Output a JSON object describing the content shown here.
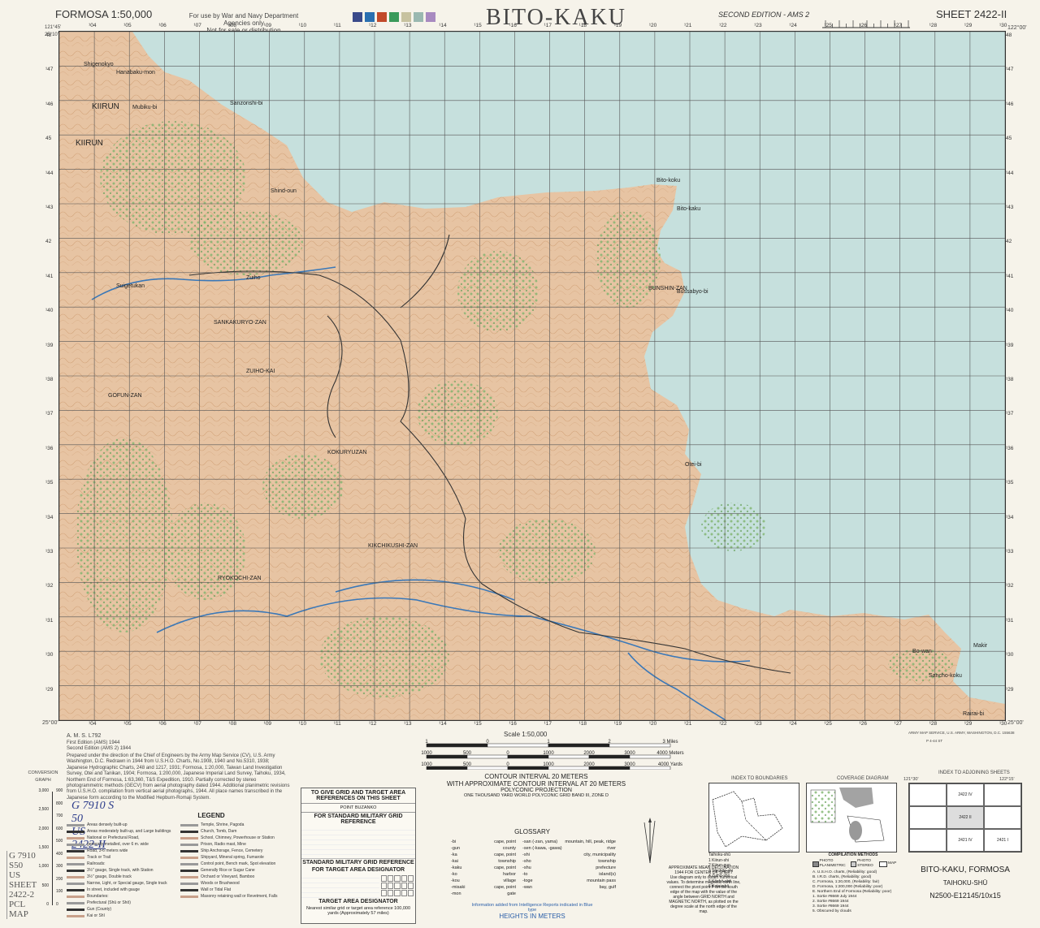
{
  "header": {
    "series": "FORMOSA 1:50,000",
    "use_note_line1": "For use by War and Navy Department Agencies only",
    "use_note_line2": "Not for sale or distribution",
    "title": "BITO-KAKU",
    "edition": "SECOND EDITION - AMS 2",
    "sheet": "SHEET 2422-II",
    "swatch_colors": [
      "#3a4a8a",
      "#2a6fb0",
      "#c24a2a",
      "#3a9a5a",
      "#c7c2a0",
      "#9ab8b0",
      "#a88ac0"
    ]
  },
  "map": {
    "sea_color": "#c6e0dd",
    "land_color": "#e7c4a3",
    "forest_color": "#9cc48a",
    "grid_color": "#555",
    "grid_col_labels": [
      "¹04",
      "¹05",
      "¹06",
      "¹07",
      "¹08",
      "¹09",
      "¹10",
      "¹11",
      "¹12",
      "¹13",
      "¹14",
      "¹15",
      "¹16",
      "¹17",
      "¹18",
      "¹19",
      "¹20",
      "¹21",
      "¹22",
      "¹23",
      "¹24",
      "¹25",
      "¹26",
      "¹27",
      "¹28",
      "¹29",
      "¹30"
    ],
    "grid_row_labels": [
      "48",
      "¹47",
      "¹46",
      "45",
      "¹44",
      "¹43",
      "42",
      "¹41",
      "¹40",
      "¹39",
      "¹38",
      "¹37",
      "¹36",
      "¹35",
      "¹34",
      "¹33",
      "¹32",
      "¹31",
      "¹30",
      "¹29"
    ],
    "corner_nw": "121°45'\n25°10'",
    "corner_ne": "122°00'",
    "corner_se": "25°00'",
    "corner_sw": "25°00'",
    "places": [
      {
        "name": "Shigenokyo",
        "size": "small"
      },
      {
        "name": "Hanabaku-mon",
        "size": "small"
      },
      {
        "name": "KIIRUN",
        "size": "big"
      },
      {
        "name": "KIIRUN",
        "size": "big"
      },
      {
        "name": "Mubiku-bi",
        "size": "small"
      },
      {
        "name": "Sanzonshi-bi",
        "size": "small"
      },
      {
        "name": "Shind-oun",
        "size": "small"
      },
      {
        "name": "Bito-koku",
        "size": "small"
      },
      {
        "name": "Bito-kaku",
        "size": "small"
      },
      {
        "name": "Suigetukan",
        "size": "small"
      },
      {
        "name": "Zuiho",
        "size": "small"
      },
      {
        "name": "BUNSHIN-ZAN",
        "size": "small"
      },
      {
        "name": "Bussabyo-bi",
        "size": "small"
      },
      {
        "name": "SANKAKURYO-ZAN",
        "size": "small"
      },
      {
        "name": "ZUIHO-KAI",
        "size": "small"
      },
      {
        "name": "GOFUN-ZAN",
        "size": "small"
      },
      {
        "name": "Otei-bi",
        "size": "small"
      },
      {
        "name": "KOKURYUZAN",
        "size": "small"
      },
      {
        "name": "KIKCHIKUSHI-ZAN",
        "size": "small"
      },
      {
        "name": "RYOKOCHI-ZAN",
        "size": "small"
      },
      {
        "name": "Bo-wan",
        "size": "small"
      },
      {
        "name": "Rairai-bi",
        "size": "small"
      },
      {
        "name": "Sancho-koku",
        "size": "small"
      },
      {
        "name": "Makir",
        "size": "small"
      }
    ],
    "sheet_numbers_note": "grid reference numerals"
  },
  "bottom_left": {
    "ams": "A. M. S. L792",
    "edition1": "First Edition (AMS) 1944",
    "edition2": "Second Edition (AMS 2) 1944",
    "compilation": "Prepared under the direction of the Chief of Engineers by the Army Map Service (CV), U.S. Army Washington, D.C. Redrawn in 1944 from U.S.H.O. Charts, No.1908, 1940 and No.5310, 1938; Japanese Hydrographic Charts, 248 and 1217, 1931; Formosa, 1:20,000, Taiwan Land Investigation Survey, Otei and Tanikan, 1904; Formosa, 1:200,000, Japanese Imperial Land Survey, Taihoku, 1934, Northern End of Formosa, 1:63,360, T&S Expedition, 1910. Partially corrected by stereo photogrammetric methods (GECV) from aerial photography dated 1944. Additional planimetric revisions from U.S.H.O. compilation from vertical aerial photographs, 1944. All place names transcribed in the Japanese form according to the Modified Hepburn-Romaji System.",
    "conversion_graph_title": "CONVERSION GRAPH",
    "conversion_ticks_ft": [
      "3,000",
      "2,500",
      "2,000",
      "1,500",
      "1,000",
      "500",
      "0"
    ],
    "conversion_ticks_m": [
      "900",
      "800",
      "700",
      "600",
      "500",
      "400",
      "300",
      "200",
      "100",
      "0"
    ],
    "legend_title": "LEGEND",
    "legend_items": [
      "Areas densely built-up",
      "Areas moderately built-up, and Large buildings",
      "National or Prefectural Road,",
      "generally metalled, over 6 m. wide",
      "Road, 3-6 meters wide",
      "Track or Trail",
      "Railroads:",
      "3½″ gauge, Single track, with Station",
      "3½″ gauge, Double track",
      "Narrow, Light, or Special gauge, Single track",
      "In street, included with gauge",
      "Boundaries:",
      "Prefectural (Shū or Shō)",
      "Gun (County)",
      "Kai or Shī",
      "Temple, Shrine, Pagoda",
      "Church, Tomb, Dam",
      "School, Chimney, Powerhouse or Station",
      "Prison, Radio mast, Mine",
      "Ship Anchorage, Fence, Cemetery",
      "Shipyard, Mineral spring, Fumarole",
      "Control point, Bench mark, Spot elevation",
      "Generally Rice or Sugar Cane",
      "Orchard or Vineyard, Bamboo",
      "Woods or Brushwood",
      "Wall or Tidal Flat",
      "Masonry retaining wall or Revetment, Falls"
    ],
    "stamp_lines": [
      "G 7910",
      "S50",
      "US",
      "SHEET",
      "2422-2",
      "PCL MAP"
    ],
    "handwriting": [
      "G 7910 S",
      "50",
      "US",
      "2422-II"
    ]
  },
  "grid_ref_box": {
    "title1": "TO GIVE GRID AND TARGET AREA REFERENCES ON THIS SHEET",
    "title2": "FOR STANDARD MILITARY GRID REFERENCE",
    "title3": "STANDARD MILITARY GRID REFERENCE",
    "title4": "FOR TARGET AREA DESIGNATOR",
    "title5": "TARGET AREA DESIGNATOR",
    "point": "POINT BUZANKO",
    "footer": "Nearest similar grid or target area reference 100,000 yards (Approximately 57 miles)"
  },
  "center_bottom": {
    "scale_label": "Scale 1:50,000",
    "miles_ticks": [
      "1",
      "0",
      "1",
      "2",
      "3 Miles"
    ],
    "meters_ticks": [
      "1000",
      "500",
      "0",
      "1000",
      "2000",
      "3000",
      "4000 Meters"
    ],
    "yards_ticks": [
      "1000",
      "500",
      "0",
      "1000",
      "2000",
      "3000",
      "4000 Yards"
    ],
    "contour1": "CONTOUR INTERVAL 20 METERS",
    "contour2": "WITH APPROXIMATE CONTOUR INTERVAL AT 20 METERS",
    "projection": "POLYCONIC PROJECTION",
    "grid_note": "ONE THOUSAND YARD WORLD POLYCONIC GRID BAND III, ZONE D",
    "glossary_title": "GLOSSARY",
    "glossary_left": [
      [
        "-bi",
        "cape, point"
      ],
      [
        "-gun",
        "county"
      ],
      [
        "-ka",
        "cape, point"
      ],
      [
        "-kai",
        "township"
      ],
      [
        "-kaku",
        "cape, point"
      ],
      [
        "-ko",
        "harbor"
      ],
      [
        "-kou",
        "village"
      ],
      [
        "-misaki",
        "cape, point"
      ],
      [
        "-mon",
        "gate"
      ]
    ],
    "glossary_right": [
      [
        "-san (-zan, yama)",
        "mountain, hill, peak, ridge"
      ],
      [
        "-sen (-kawa, -gawa)",
        "river"
      ],
      [
        "-shi",
        "city, municipality"
      ],
      [
        "-sho",
        "township"
      ],
      [
        "-shu",
        "prefecture"
      ],
      [
        "-to",
        "island(s)"
      ],
      [
        "-toge",
        "mountain pass"
      ],
      [
        "-wan",
        "bay, gulf"
      ]
    ],
    "info_note": "Information added from Intelligence Reports indicated in Blue type",
    "heights": "HEIGHTS IN METERS",
    "declination_title": "APPROXIMATE MEAN DECLINATION 1944 FOR CENTER OF SHEET",
    "declination_body": "Use diagram only to obtain numerical values. To determine magnetic north line, connect the pivot point P on the south edge of the map with the value of the angle between GRID NORTH and MAGNETIC NORTH, as plotted on the degree scale at the north edge of the map."
  },
  "index_boundaries": {
    "title": "INDEX TO BOUNDARIES",
    "items": [
      "Taihoku-shū",
      "1 Kiirun-shi",
      "2 Kiirun-gun",
      "3 Shichito-shi",
      "4 Zuihō-sho",
      "5 Kōshō-shō",
      "6 Kotai-shō"
    ]
  },
  "coverage": {
    "title": "COVERAGE DIAGRAM",
    "methods": "COMPILATION METHODS",
    "legend": [
      "PHOTO PLANIMETRIC",
      "PHOTO STEREO",
      "MAP"
    ],
    "notes": [
      "A. U.S.H.O. charts, (Reliability: good)",
      "B. I.R.D. charts, (Reliability: good)",
      "C. Formosa, 1:20,000, (Reliability: fair)",
      "D. Formosa, 1:200,000 (Reliability: poor)",
      "E. Northern End of Formosa (Reliability: poor)",
      "1. Sortie #8669 July 1944",
      "2. Sortie #8669 1944",
      "3. Sortie #8669 1944",
      "5. Obscured by clouds"
    ]
  },
  "adjoining": {
    "title": "INDEX TO ADJOINING SHEETS",
    "sheets": [
      "2422 IV",
      "2422 II",
      "2421 IV",
      "2421 I"
    ],
    "corners": [
      "121°30'",
      "122°15'"
    ]
  },
  "footer": {
    "name": "BITO-KAKU, FORMOSA",
    "province": "TAIHOKU-SHŪ",
    "code": "N2500-E12145/10x15",
    "printer": "ARMY MAP SERVICE, U.S. ARMY, WASHINGTON, D.C. 155638",
    "printer2": "P 4-44 ST"
  }
}
